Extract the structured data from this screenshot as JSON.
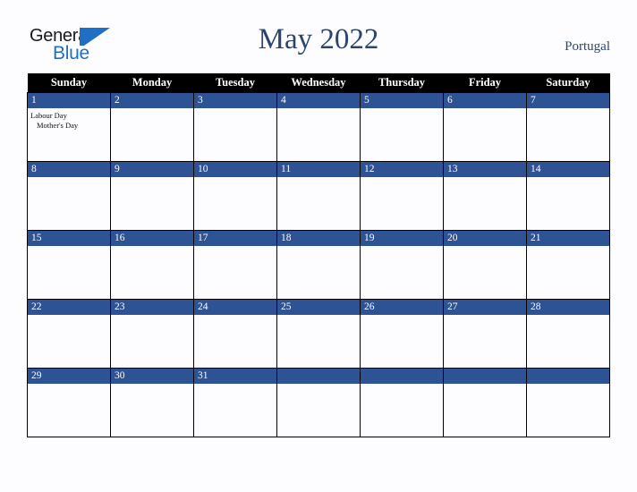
{
  "brand": {
    "line1": "General",
    "line2": "Blue",
    "color_dark": "#1a1a1a",
    "color_blue": "#1f6fc4"
  },
  "header": {
    "title": "May 2022",
    "country": "Portugal",
    "title_color": "#2b4570"
  },
  "calendar": {
    "weekday_headers": [
      "Sunday",
      "Monday",
      "Tuesday",
      "Wednesday",
      "Thursday",
      "Friday",
      "Saturday"
    ],
    "header_bg": "#000000",
    "daynum_bg": "#2e5395",
    "weeks": [
      [
        {
          "day": "1",
          "events": [
            {
              "text": "Labour Day",
              "indent": false
            },
            {
              "text": "Mother's Day",
              "indent": true
            }
          ]
        },
        {
          "day": "2",
          "events": []
        },
        {
          "day": "3",
          "events": []
        },
        {
          "day": "4",
          "events": []
        },
        {
          "day": "5",
          "events": []
        },
        {
          "day": "6",
          "events": []
        },
        {
          "day": "7",
          "events": []
        }
      ],
      [
        {
          "day": "8",
          "events": []
        },
        {
          "day": "9",
          "events": []
        },
        {
          "day": "10",
          "events": []
        },
        {
          "day": "11",
          "events": []
        },
        {
          "day": "12",
          "events": []
        },
        {
          "day": "13",
          "events": []
        },
        {
          "day": "14",
          "events": []
        }
      ],
      [
        {
          "day": "15",
          "events": []
        },
        {
          "day": "16",
          "events": []
        },
        {
          "day": "17",
          "events": []
        },
        {
          "day": "18",
          "events": []
        },
        {
          "day": "19",
          "events": []
        },
        {
          "day": "20",
          "events": []
        },
        {
          "day": "21",
          "events": []
        }
      ],
      [
        {
          "day": "22",
          "events": []
        },
        {
          "day": "23",
          "events": []
        },
        {
          "day": "24",
          "events": []
        },
        {
          "day": "25",
          "events": []
        },
        {
          "day": "26",
          "events": []
        },
        {
          "day": "27",
          "events": []
        },
        {
          "day": "28",
          "events": []
        }
      ],
      [
        {
          "day": "29",
          "events": []
        },
        {
          "day": "30",
          "events": []
        },
        {
          "day": "31",
          "events": []
        },
        {
          "day": "",
          "events": []
        },
        {
          "day": "",
          "events": []
        },
        {
          "day": "",
          "events": []
        },
        {
          "day": "",
          "events": []
        }
      ]
    ]
  }
}
